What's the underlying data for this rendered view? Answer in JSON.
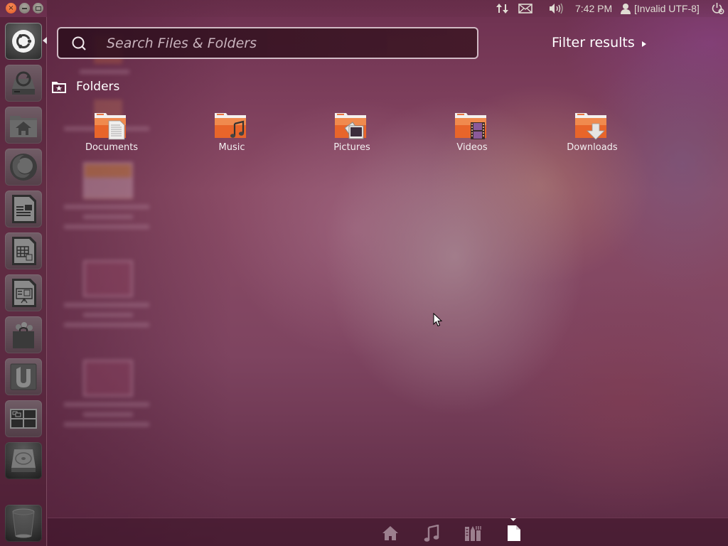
{
  "window_controls": {
    "close_icon": "close-icon",
    "minimize_icon": "minimize-icon",
    "maximize_icon": "maximize-icon",
    "close_glyph": "×"
  },
  "top_panel": {
    "indicators": {
      "network_icon": "network-updown-icon",
      "mail_icon": "mail-envelope-icon",
      "sound_icon": "speaker-volume-icon",
      "clock": "7:42 PM",
      "user_icon": "user-silhouette-icon",
      "user_name": "[Invalid UTF-8]",
      "session_icon": "power-gear-icon"
    }
  },
  "launcher": {
    "items": [
      {
        "name": "dash-home",
        "icon": "ubuntu-logo-icon"
      },
      {
        "name": "update-manager",
        "icon": "update-manager-icon"
      },
      {
        "name": "home-folder",
        "icon": "home-folder-icon"
      },
      {
        "name": "firefox",
        "icon": "firefox-icon"
      },
      {
        "name": "libreoffice-writer",
        "icon": "writer-document-icon"
      },
      {
        "name": "libreoffice-calc",
        "icon": "calc-spreadsheet-icon"
      },
      {
        "name": "libreoffice-impress",
        "icon": "impress-presentation-icon"
      },
      {
        "name": "software-center",
        "icon": "shopping-bag-icon"
      },
      {
        "name": "ubuntu-one",
        "icon": "ubuntu-one-icon"
      },
      {
        "name": "workspace-switcher",
        "icon": "workspace-grid-icon"
      },
      {
        "name": "hard-drive",
        "icon": "hard-drive-icon"
      },
      {
        "name": "trash",
        "icon": "trash-icon"
      }
    ]
  },
  "search": {
    "placeholder": "Search Files & Folders",
    "value": ""
  },
  "filter": {
    "label": "Filter results"
  },
  "categories": {
    "folders": {
      "title": "Folders",
      "items": [
        {
          "label": "Documents",
          "emblem": "document"
        },
        {
          "label": "Music",
          "emblem": "music"
        },
        {
          "label": "Pictures",
          "emblem": "picture"
        },
        {
          "label": "Videos",
          "emblem": "video"
        },
        {
          "label": "Downloads",
          "emblem": "download"
        }
      ]
    }
  },
  "lens_bar": {
    "lenses": [
      {
        "name": "home",
        "icon": "home-lens-icon",
        "active": false
      },
      {
        "name": "music",
        "icon": "music-lens-icon",
        "active": false
      },
      {
        "name": "applications",
        "icon": "applications-lens-icon",
        "active": false
      },
      {
        "name": "files",
        "icon": "files-lens-icon",
        "active": true
      }
    ]
  },
  "colors": {
    "folder_orange": "#e8652a",
    "close_button": "#e25a24",
    "text": "#ffffff"
  }
}
